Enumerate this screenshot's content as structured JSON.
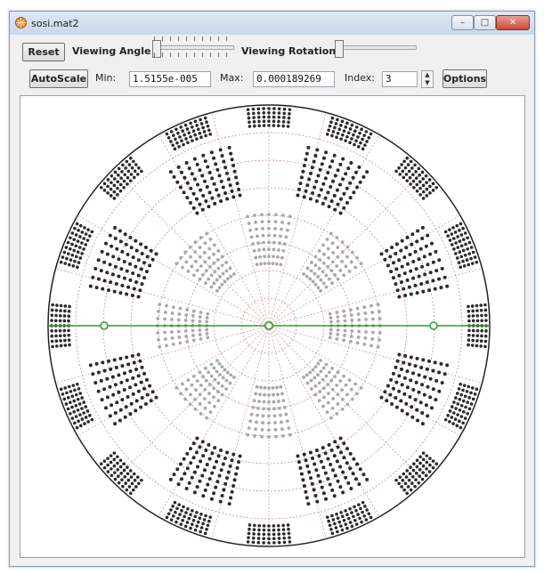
{
  "window": {
    "title": "sosi.mat2",
    "minimize_label": "–",
    "maximize_label": "□",
    "close_label": "✕"
  },
  "toolbar": {
    "reset_label": "Reset",
    "viewing_angle_label": "Viewing Angle",
    "viewing_rotation_label": "Viewing Rotation",
    "autoscale_label": "AutoScale",
    "min_label": "Min:",
    "min_value": "1.5155e-005",
    "max_label": "Max:",
    "max_value": "0.000189269",
    "index_label": "Index:",
    "index_value": "3",
    "options_label": "Options",
    "viewing_angle_level": 0.0,
    "viewing_rotation_level": 0.0
  },
  "plot": {
    "chart_data": {
      "type": "scatter",
      "description_series": [
        {
          "name": "outer-ring-segments",
          "count": 16
        },
        {
          "name": "mid-ring-segments",
          "count": 8
        },
        {
          "name": "inner-ring-segments",
          "count": 8
        }
      ],
      "grid": "polar",
      "grid_color": "#c08080",
      "dot_color": "#2a2a2a",
      "inner_dot_color": "#a8a8a8",
      "line_color": "#2e9e2e"
    }
  }
}
